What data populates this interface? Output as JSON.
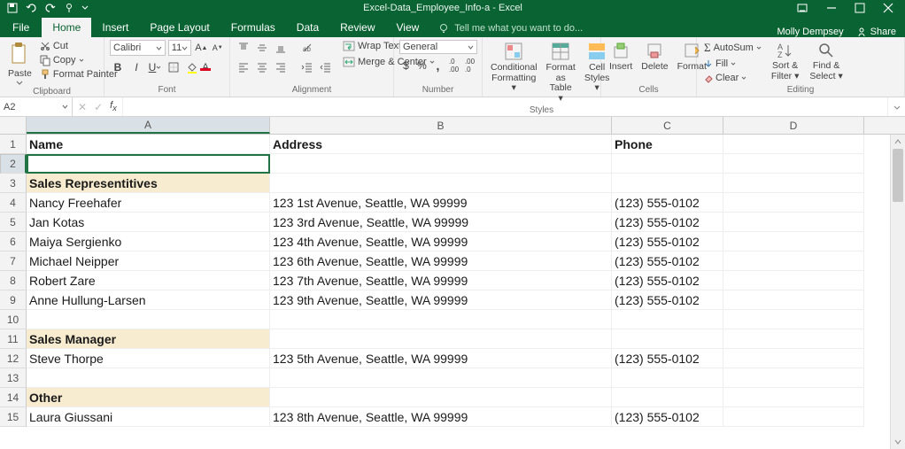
{
  "title": "Excel-Data_Employee_Info-a - Excel",
  "user": "Molly Dempsey",
  "share": "Share",
  "tabs": {
    "file": "File",
    "home": "Home",
    "insert": "Insert",
    "pagelayout": "Page Layout",
    "formulas": "Formulas",
    "data": "Data",
    "review": "Review",
    "view": "View",
    "tellme": "Tell me what you want to do..."
  },
  "ribbon": {
    "clipboard": {
      "label": "Clipboard",
      "paste": "Paste",
      "cut": "Cut",
      "copy": "Copy",
      "fmtpainter": "Format Painter"
    },
    "font": {
      "label": "Font",
      "name": "Calibri",
      "size": "11"
    },
    "alignment": {
      "label": "Alignment",
      "wrap": "Wrap Text",
      "merge": "Merge & Center"
    },
    "number": {
      "label": "Number",
      "format": "General"
    },
    "styles": {
      "label": "Styles",
      "cond": "Conditional Formatting",
      "fmt": "Format as Table",
      "cell": "Cell Styles"
    },
    "cells": {
      "label": "Cells",
      "insert": "Insert",
      "delete": "Delete",
      "format": "Format"
    },
    "editing": {
      "label": "Editing",
      "autosum": "AutoSum",
      "fill": "Fill",
      "clear": "Clear",
      "sortfind": "Sort & Filter",
      "findsel": "Find & Select"
    }
  },
  "namebox": "A2",
  "colHeaders": [
    "A",
    "B",
    "C",
    "D"
  ],
  "sheet": {
    "rows": [
      {
        "n": 1,
        "A": "Name",
        "B": "Address",
        "C": "Phone",
        "cls": "hdr"
      },
      {
        "n": 2,
        "A": "",
        "B": "",
        "C": "",
        "active": true
      },
      {
        "n": 3,
        "A": "Sales Representitives",
        "B": "",
        "C": "",
        "cls": "section"
      },
      {
        "n": 4,
        "A": "Nancy Freehafer",
        "B": "123 1st Avenue, Seattle, WA 99999",
        "C": "(123) 555-0102"
      },
      {
        "n": 5,
        "A": "Jan Kotas",
        "B": "123 3rd Avenue, Seattle, WA 99999",
        "C": "(123) 555-0102"
      },
      {
        "n": 6,
        "A": "Maiya Sergienko",
        "B": "123 4th Avenue, Seattle, WA 99999",
        "C": "(123) 555-0102"
      },
      {
        "n": 7,
        "A": "Michael Neipper",
        "B": "123 6th Avenue, Seattle, WA 99999",
        "C": "(123) 555-0102"
      },
      {
        "n": 8,
        "A": "Robert Zare",
        "B": "123 7th Avenue, Seattle, WA 99999",
        "C": "(123) 555-0102"
      },
      {
        "n": 9,
        "A": "Anne Hullung-Larsen",
        "B": "123 9th Avenue, Seattle, WA 99999",
        "C": "(123) 555-0102"
      },
      {
        "n": 10,
        "A": "",
        "B": "",
        "C": ""
      },
      {
        "n": 11,
        "A": "Sales Manager",
        "B": "",
        "C": "",
        "cls": "section"
      },
      {
        "n": 12,
        "A": "Steve Thorpe",
        "B": "123 5th Avenue, Seattle, WA 99999",
        "C": "(123) 555-0102"
      },
      {
        "n": 13,
        "A": "",
        "B": "",
        "C": ""
      },
      {
        "n": 14,
        "A": "Other",
        "B": "",
        "C": "",
        "cls": "section"
      },
      {
        "n": 15,
        "A": "Laura Giussani",
        "B": "123 8th Avenue, Seattle, WA 99999",
        "C": "(123) 555-0102"
      }
    ]
  }
}
